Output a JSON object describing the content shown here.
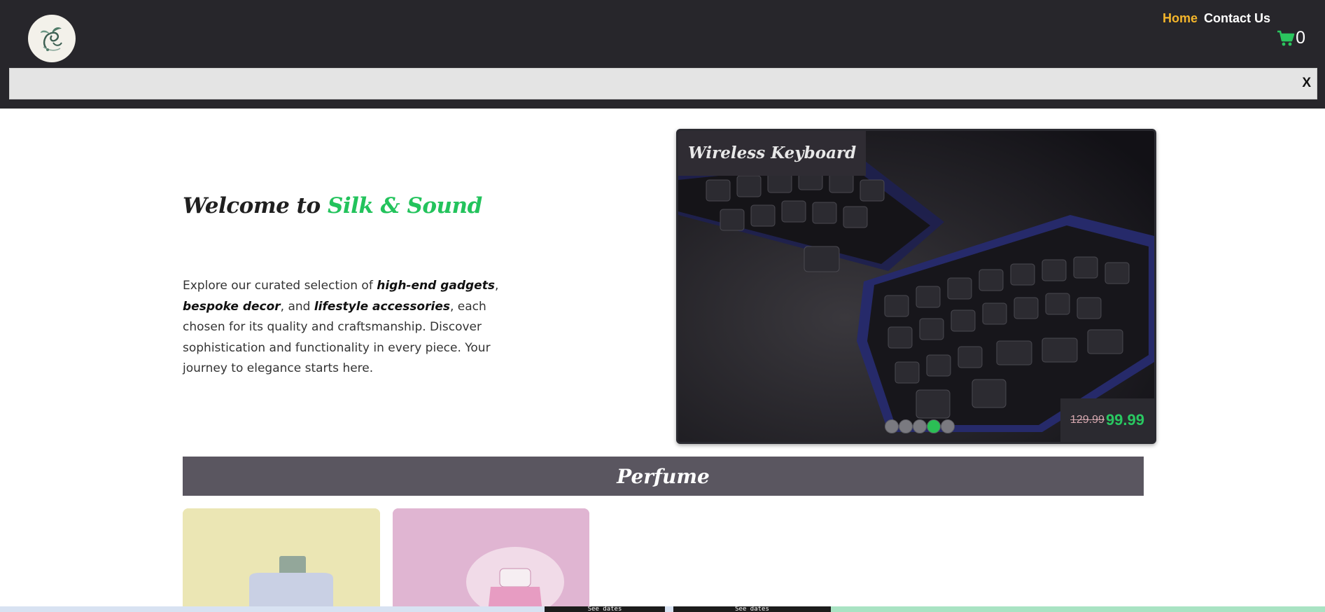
{
  "header": {
    "logo_icon": "silk-sound-logo",
    "nav": [
      {
        "label": "Home",
        "color": "#f5b62b"
      },
      {
        "label": "Contact Us",
        "color": "#ffffff"
      }
    ],
    "cart": {
      "icon": "cart-icon",
      "count": "0",
      "icon_color": "#2bc45e"
    }
  },
  "banner": {
    "close_label": "X"
  },
  "hero": {
    "welcome_prefix": "Welcome to ",
    "brand": "Silk & Sound",
    "intro_parts": [
      "Explore our curated selection of ",
      "high-end gadgets",
      ", ",
      "bespoke decor",
      ", and ",
      "lifestyle accessories",
      ", each chosen for its quality and craftsmanship. Discover sophistication and functionality in every piece. Your journey to elegance starts here."
    ]
  },
  "carousel": {
    "title": "Wireless Keyboard",
    "old_price": "129.99",
    "new_price": "99.99",
    "dot_count": 5,
    "active_dot": 4
  },
  "category": {
    "title": "Perfume"
  },
  "bottom_strip": {
    "seg1": "See dates",
    "seg2": "See dates"
  },
  "colors": {
    "accent": "#23c35c",
    "header_bg": "#27262b",
    "home_link": "#f5b62b"
  }
}
